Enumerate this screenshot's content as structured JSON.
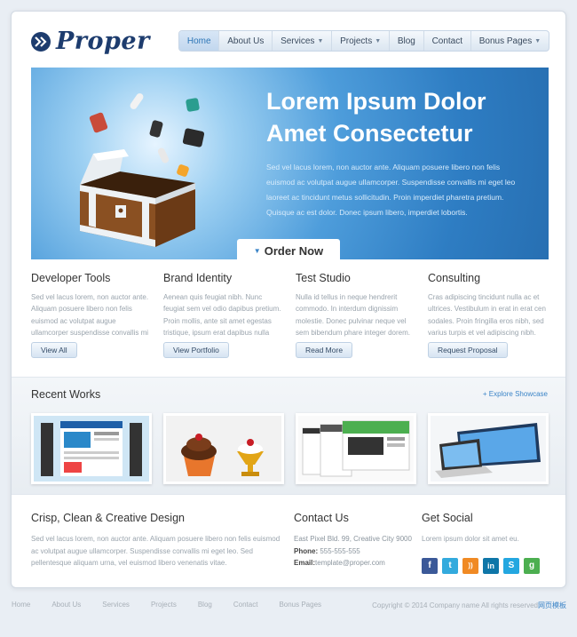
{
  "brand": {
    "name": "Proper",
    "accent": "#2d76b7",
    "logo_color": "#1d3c6e"
  },
  "nav": {
    "items": [
      {
        "label": "Home",
        "active": true,
        "dropdown": false
      },
      {
        "label": "About Us",
        "active": false,
        "dropdown": false
      },
      {
        "label": "Services",
        "active": false,
        "dropdown": true
      },
      {
        "label": "Projects",
        "active": false,
        "dropdown": true
      },
      {
        "label": "Blog",
        "active": false,
        "dropdown": false
      },
      {
        "label": "Contact",
        "active": false,
        "dropdown": false
      },
      {
        "label": "Bonus Pages",
        "active": false,
        "dropdown": true
      }
    ]
  },
  "hero": {
    "title_line1": "Lorem Ipsum Dolor",
    "title_line2": "Amet Consectetur",
    "text": "Sed vel lacus lorem, non auctor ante. Aliquam posuere libero non felis euismod ac volutpat augue ullamcorper. Suspendisse convallis mi eget leo laoreet ac tincidunt metus sollicitudin. Proin imperdiet pharetra pretium. Quisque ac est dolor. Donec ipsum libero, imperdiet lobortis.",
    "cta": "Order Now"
  },
  "features": [
    {
      "title": "Developer Tools",
      "text": "Sed vel lacus lorem, non auctor ante. Aliquam posuere libero non felis euismod ac volutpat augue ullamcorper suspendisse convallis mi eget leo.",
      "button": "View All"
    },
    {
      "title": "Brand Identity",
      "text": "Aenean quis feugiat nibh. Nunc feugiat sem vel odio dapibus pretium. Proin mollis, ante sit amet egestas tristique, ipsum erat dapibus nulla dolor porta.",
      "button": "View Portfolio"
    },
    {
      "title": "Test Studio",
      "text": "Nulla id tellus in neque hendrerit commodo. In interdum dignissim molestie. Donec pulvinar neque vel sem bibendum phare integer dorem.",
      "button": "Read More"
    },
    {
      "title": "Consulting",
      "text": "Cras adipiscing tincidunt nulla ac et ultrices. Vestibulum in erat in erat cen sodales. Proin fringilla eros nibh, sed varius turpis et vel adipiscing nibh.",
      "button": "Request Proposal"
    }
  ],
  "works": {
    "title": "Recent Works",
    "explore": "+ Explore Showcase"
  },
  "about": {
    "title": "Crisp, Clean & Creative Design",
    "text": "Sed vel lacus lorem, non auctor ante. Aliquam posuere libero non felis euismod ac volutpat augue ullamcorper. Suspendisse convallis mi eget leo. Sed pellentesque aliquam urna, vel euismod libero venenatis vitae."
  },
  "contact": {
    "title": "Contact Us",
    "address": "East Pixel Bld. 99, Creative City 9000",
    "phone_label": "Phone:",
    "phone": "555-555-555",
    "email_label": "Email:",
    "email": "template@proper.com"
  },
  "social": {
    "title": "Get Social",
    "text": "Lorem ipsum dolor sit amet eu.",
    "icons": [
      {
        "name": "facebook-icon",
        "glyph": "f",
        "color": "#3b5998"
      },
      {
        "name": "twitter-icon",
        "glyph": "t",
        "color": "#33aadd"
      },
      {
        "name": "rss-icon",
        "glyph": "))",
        "color": "#f08a24"
      },
      {
        "name": "linkedin-icon",
        "glyph": "in",
        "color": "#0e76a8"
      },
      {
        "name": "skype-icon",
        "glyph": "S",
        "color": "#24a7e0"
      },
      {
        "name": "google-icon",
        "glyph": "g",
        "color": "#4caf50"
      }
    ]
  },
  "footer": {
    "links": [
      "Home",
      "About Us",
      "Services",
      "Projects",
      "Blog",
      "Contact",
      "Bonus Pages"
    ],
    "copyright": "Copyright © 2014 Company name All rights reserved",
    "beian": "网页模板"
  }
}
